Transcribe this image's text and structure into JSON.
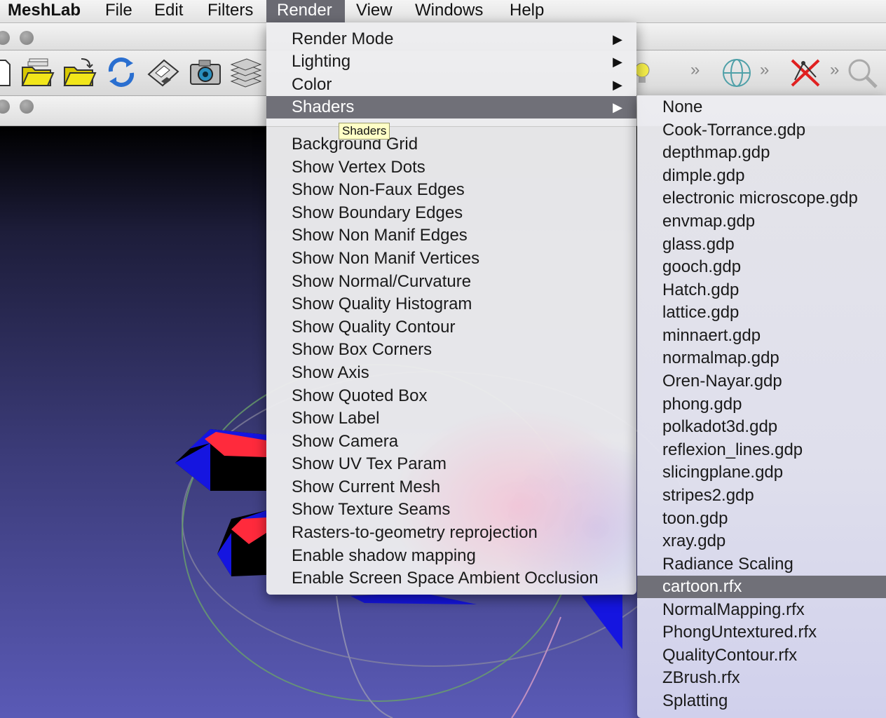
{
  "menubar": {
    "items": [
      "MeshLab",
      "File",
      "Edit",
      "Filters",
      "Render",
      "View",
      "Windows",
      "Help"
    ],
    "active": "Render"
  },
  "toolbar": {
    "icons": [
      "new-document-icon",
      "open-folder-icon",
      "open-project-folder-icon",
      "reload-icon",
      "save-icon",
      "snapshot-camera-icon",
      "layers-icon"
    ],
    "right_icons": [
      "light-bulb-icon",
      "overflow-chevron-icon",
      "sphere-grid-icon",
      "overflow-chevron-icon",
      "edit-points-cross-icon",
      "overflow-chevron-icon",
      "magnifier-icon"
    ]
  },
  "render_menu": {
    "submenus": [
      "Render Mode",
      "Lighting",
      "Color",
      "Shaders"
    ],
    "highlighted": "Shaders",
    "items": [
      "Background Grid",
      "Show Vertex Dots",
      "Show Non-Faux Edges",
      "Show Boundary Edges",
      "Show Non Manif Edges",
      "Show Non Manif Vertices",
      "Show Normal/Curvature",
      "Show Quality Histogram",
      "Show Quality Contour",
      "Show Box Corners",
      "Show Axis",
      "Show Quoted Box",
      "Show Label",
      "Show Camera",
      "Show UV Tex Param",
      "Show Current Mesh",
      "Show Texture Seams",
      "Rasters-to-geometry reprojection",
      "Enable shadow mapping",
      "Enable Screen Space Ambient Occlusion"
    ]
  },
  "tooltip": "Shaders",
  "shaders_menu": {
    "items": [
      "None",
      "Cook-Torrance.gdp",
      "depthmap.gdp",
      "dimple.gdp",
      "electronic microscope.gdp",
      "envmap.gdp",
      "glass.gdp",
      "gooch.gdp",
      "Hatch.gdp",
      "lattice.gdp",
      "minnaert.gdp",
      "normalmap.gdp",
      "Oren-Nayar.gdp",
      "phong.gdp",
      "polkadot3d.gdp",
      "reflexion_lines.gdp",
      "slicingplane.gdp",
      "stripes2.gdp",
      "toon.gdp",
      "xray.gdp",
      "Radiance Scaling",
      "cartoon.rfx",
      "NormalMapping.rfx",
      "PhongUntextured.rfx",
      "QualityContour.rfx",
      "ZBrush.rfx",
      "Splatting"
    ],
    "highlighted": "cartoon.rfx"
  },
  "colors": {
    "menu_highlight": "#707078",
    "mesh_blue": "#1010e0",
    "mesh_red": "#ff2a3c"
  }
}
